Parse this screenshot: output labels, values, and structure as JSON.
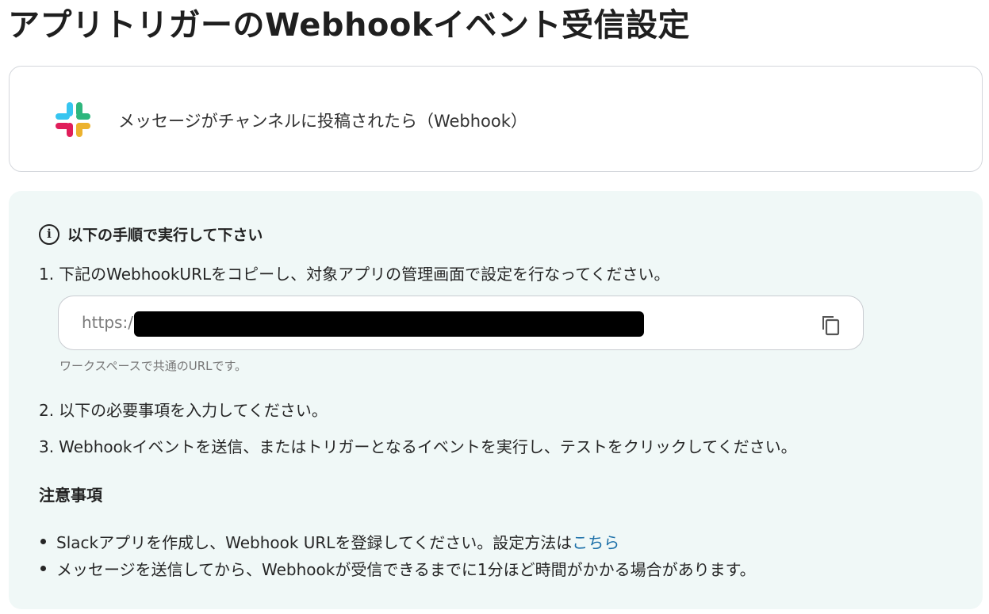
{
  "page": {
    "title": "アプリトリガーのWebhookイベント受信設定"
  },
  "trigger": {
    "icon": "slack-logo-icon",
    "name": "メッセージがチャンネルに投稿されたら（Webhook）"
  },
  "instructions": {
    "heading": "以下の手順で実行して下さい",
    "steps": [
      {
        "num": "1.",
        "text": "下記のWebhookURLをコピーし、対象アプリの管理画面で設定を行なってください。"
      },
      {
        "num": "2.",
        "text": "以下の必要事項を入力してください。"
      },
      {
        "num": "3.",
        "text": "Webhookイベントを送信、またはトリガーとなるイベントを実行し、テストをクリックしてください。"
      }
    ],
    "webhook_url": {
      "visible_prefix": "https:/",
      "hint": "ワークスペースで共通のURLです。",
      "copy_icon": "copy-icon"
    }
  },
  "notes": {
    "title": "注意事項",
    "items": [
      {
        "text": "Slackアプリを作成し、Webhook URLを登録してください。設定方法は",
        "link": "こちら"
      },
      {
        "text": "メッセージを送信してから、Webhookが受信できるまでに1分ほど時間がかかる場合があります。"
      }
    ]
  },
  "colors": {
    "panel_bg": "#f0f8f7",
    "link": "#1b6fa8",
    "slack_blue": "#36c5f0",
    "slack_green": "#2eb67d",
    "slack_yellow": "#ecb22e",
    "slack_red": "#e01e5a"
  }
}
